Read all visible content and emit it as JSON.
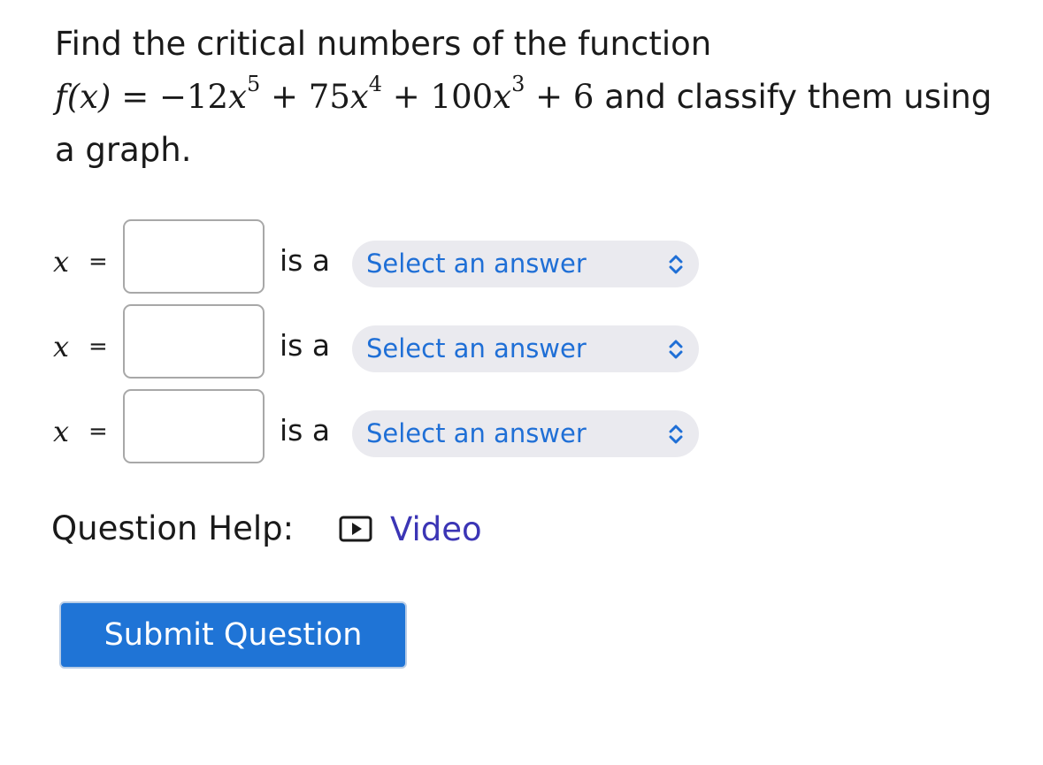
{
  "question": {
    "intro": "Find the critical numbers of the function",
    "function_label": "f(x)",
    "function_expression": {
      "equals": "=",
      "terms": [
        {
          "coef": "−12",
          "var": "x",
          "exp": "5"
        },
        {
          "op": "+",
          "coef": "75",
          "var": "x",
          "exp": "4"
        },
        {
          "op": "+",
          "coef": "100",
          "var": "x",
          "exp": "3"
        },
        {
          "op": "+",
          "const": "6"
        }
      ]
    },
    "tail": "and classify them using a graph."
  },
  "rows": [
    {
      "variable": "x",
      "equals": "=",
      "answer_value": "",
      "connector": "is a",
      "select_placeholder": "Select an answer"
    },
    {
      "variable": "x",
      "equals": "=",
      "answer_value": "",
      "connector": "is a",
      "select_placeholder": "Select an answer"
    },
    {
      "variable": "x",
      "equals": "=",
      "answer_value": "",
      "connector": "is a",
      "select_placeholder": "Select an answer"
    }
  ],
  "help": {
    "label": "Question Help:",
    "video_link": "Video",
    "icon": "play-video-icon"
  },
  "submit_label": "Submit Question",
  "colors": {
    "link_blue": "#1f6fd6",
    "video_purple": "#3b35b5",
    "submit_bg": "#1f74d6",
    "select_bg": "#eaeaef"
  }
}
